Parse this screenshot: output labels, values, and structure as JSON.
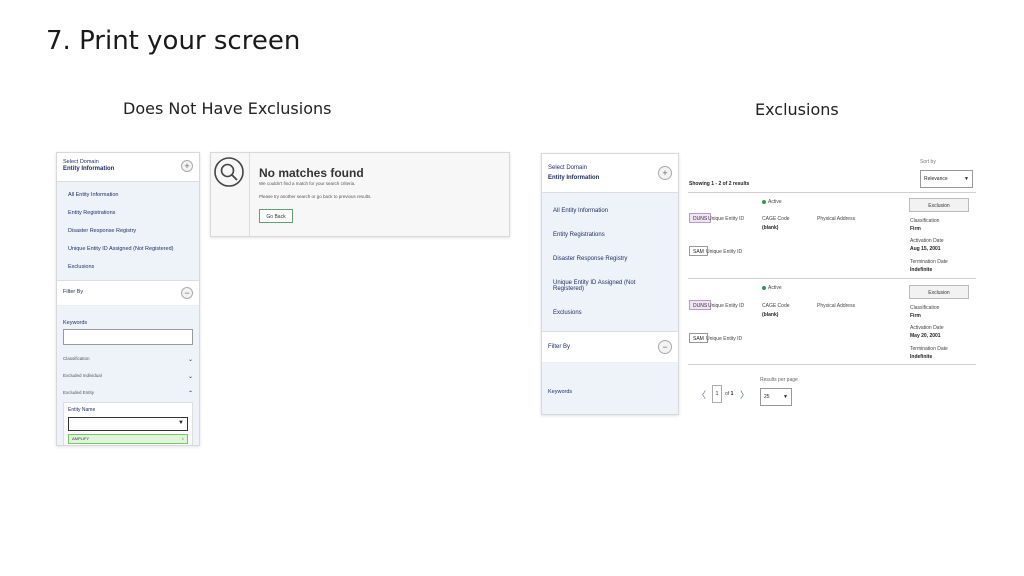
{
  "slide": {
    "title": "7. Print your screen",
    "left_caption": "Does Not Have Exclusions",
    "right_caption": "Exclusions"
  },
  "sidebar": {
    "domain_label": "Select Domain",
    "domain_value": "Entity Information",
    "items": [
      "All Entity Information",
      "Entity Registrations",
      "Disaster Response Registry",
      "Unique Entity ID Assigned (Not Registered)",
      "Exclusions"
    ],
    "filter_label": "Filter By",
    "keywords_label": "Keywords",
    "accordions": [
      {
        "label": "Classification",
        "chevron": "⌄"
      },
      {
        "label": "Excluded Individual",
        "chevron": "⌄"
      },
      {
        "label": "Excluded Entity",
        "chevron": "⌃"
      }
    ],
    "entity_name_label": "Entity Name",
    "entity_tag": "AMPLIFY"
  },
  "no_matches": {
    "title": "No matches found",
    "line1": "We couldn't find a match for your search criteria.",
    "line2": "Please try another search or go back to previous results.",
    "button": "Go Back"
  },
  "results": {
    "sort_label": "Sort by",
    "sort_value": "Relevance",
    "showing": "Showing 1 - 2 of 2 results",
    "cards": [
      {
        "status": "Active",
        "duns": "DUNS",
        "uei_label": "Unique Entity ID",
        "cage_label": "CAGE Code",
        "cage_value": "(blank)",
        "address_label": "Physical Address",
        "sam": "SAM",
        "exclusion_button": "Exclusion",
        "classification_label": "Classification",
        "classification_value": "Firm",
        "activation_label": "Activation Date",
        "activation_value": "Aug 15, 2001",
        "termination_label": "Termination Date",
        "termination_value": "Indefinite"
      },
      {
        "status": "Active",
        "duns": "DUNS",
        "uei_label": "Unique Entity ID",
        "cage_label": "CAGE Code",
        "cage_value": "(blank)",
        "address_label": "Physical Address",
        "sam": "SAM",
        "exclusion_button": "Exclusion",
        "classification_label": "Classification",
        "classification_value": "Firm",
        "activation_label": "Activation Date",
        "activation_value": "May 20, 2001",
        "termination_label": "Termination Date",
        "termination_value": "Indefinite"
      }
    ],
    "pager": {
      "page": "1",
      "of": "of",
      "total": "1",
      "prev": "〈",
      "next": "〉"
    },
    "per_page_label": "Results per page",
    "per_page_value": "25"
  }
}
